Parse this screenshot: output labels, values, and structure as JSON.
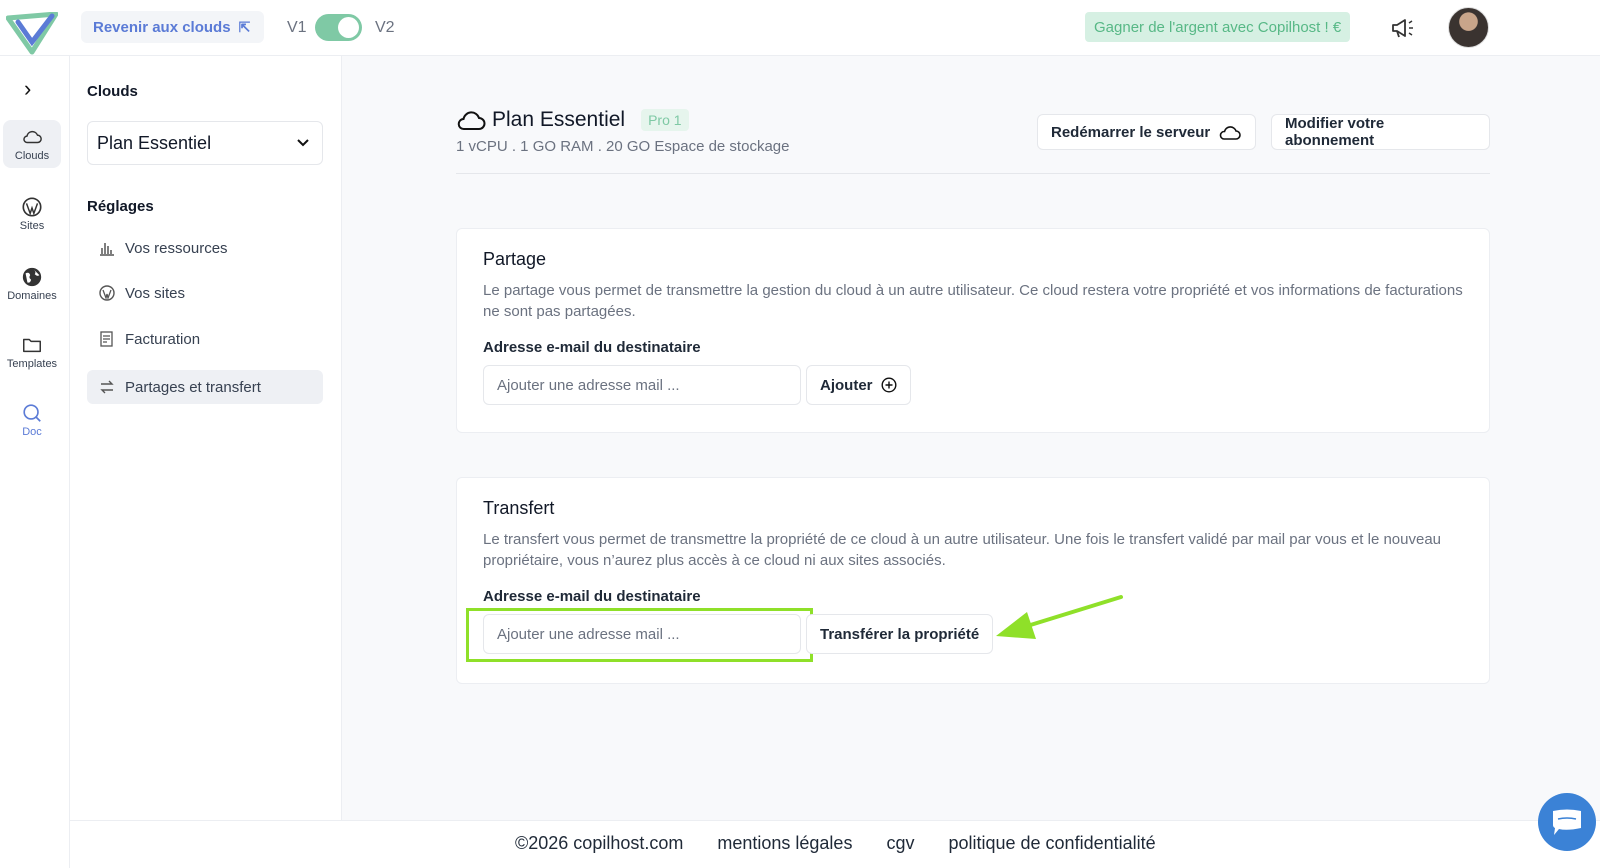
{
  "topbar": {
    "back_label": "Revenir aux clouds",
    "v1_label": "V1",
    "v2_label": "V2",
    "earn_label": "Gagner de l'argent avec Copilhost ! €"
  },
  "rail": {
    "items": [
      {
        "label": "Clouds",
        "icon": "cloud-icon"
      },
      {
        "label": "Sites",
        "icon": "wordpress-icon"
      },
      {
        "label": "Domaines",
        "icon": "globe-icon"
      },
      {
        "label": "Templates",
        "icon": "folder-icon"
      },
      {
        "label": "Doc",
        "icon": "search-icon"
      }
    ]
  },
  "sidebar": {
    "clouds_title": "Clouds",
    "selected_cloud": "Plan Essentiel",
    "settings_title": "Réglages",
    "items": [
      {
        "label": "Vos ressources",
        "icon": "bar-chart-icon"
      },
      {
        "label": "Vos sites",
        "icon": "wordpress-icon"
      },
      {
        "label": "Facturation",
        "icon": "invoice-icon"
      },
      {
        "label": "Partages et transfert",
        "icon": "swap-icon"
      }
    ]
  },
  "plan": {
    "title": "Plan Essentiel",
    "badge": "Pro 1",
    "specs": "1 vCPU . 1 GO RAM . 20 GO Espace de stockage",
    "restart_label": "Redémarrer le serveur",
    "modify_label": "Modifier votre abonnement"
  },
  "sharing": {
    "title": "Partage",
    "description": "Le partage vous permet de transmettre la gestion du cloud à un autre utilisateur. Ce cloud restera votre propriété et vos informations de facturations ne sont pas partagées.",
    "field_label": "Adresse e-mail du destinataire",
    "placeholder": "Ajouter une adresse mail ...",
    "button_label": "Ajouter"
  },
  "transfer": {
    "title": "Transfert",
    "description": "Le transfert vous permet de transmettre la propriété de ce cloud à un autre utilisateur. Une fois le transfert validé par mail par vous et le nouveau propriétaire, vous n’aurez plus accès à ce cloud ni aux sites associés.",
    "field_label": "Adresse e-mail du destinataire",
    "placeholder": "Ajouter une adresse mail ...",
    "button_label": "Transférer la propriété"
  },
  "footer": {
    "copyright": "©2026 copilhost.com",
    "links": [
      "mentions légales",
      "cgv",
      "politique de confidentialité"
    ]
  },
  "colors": {
    "accent": "#5b7bd6",
    "toggle": "#7fc9a5",
    "highlight": "#8fe029",
    "chat": "#3b82d6"
  }
}
